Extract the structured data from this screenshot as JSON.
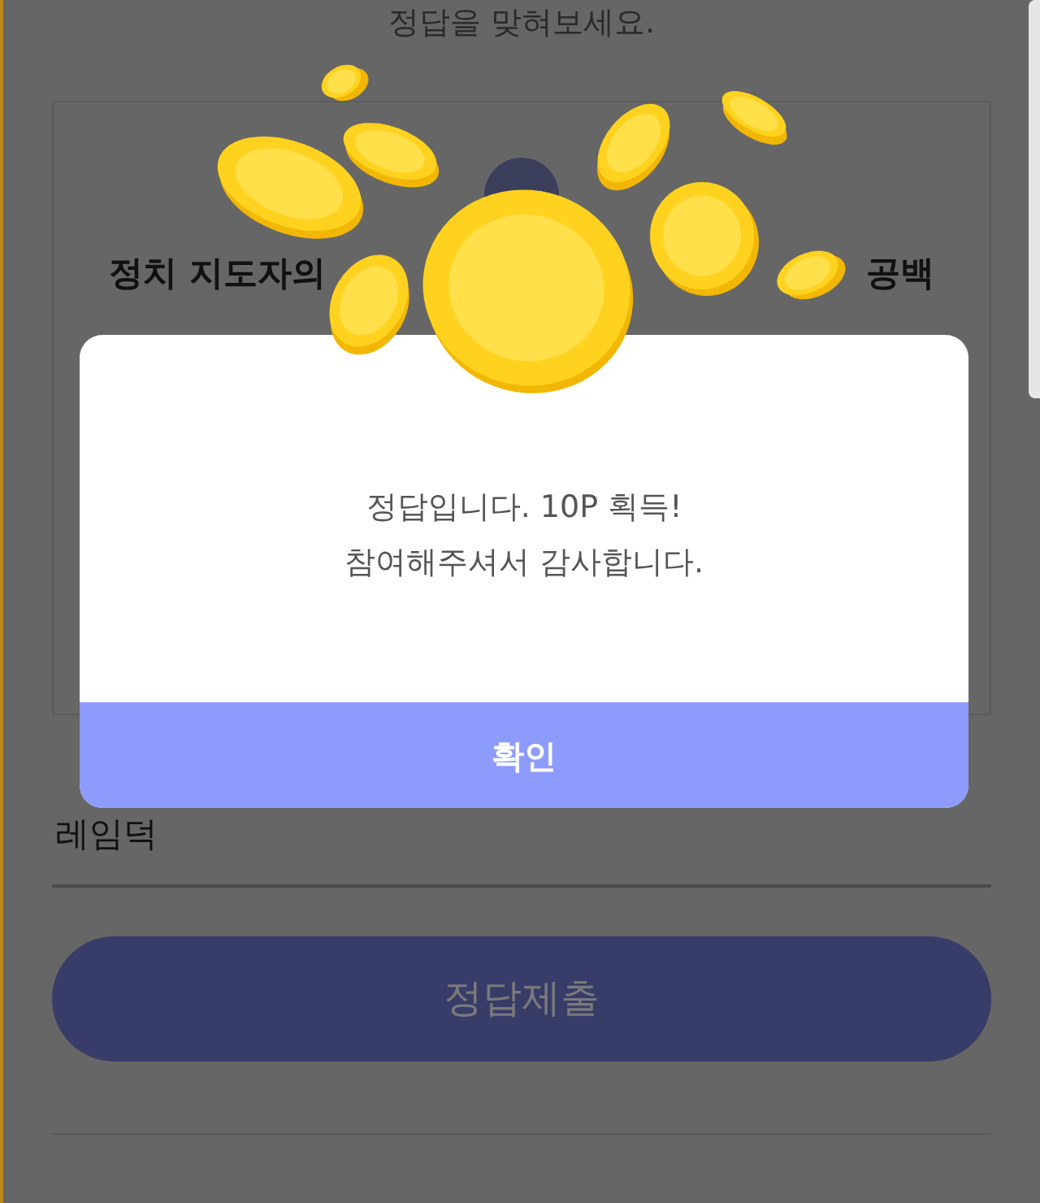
{
  "instruction": "정답을 맞혀보세요.",
  "question": {
    "title_parts": [
      "정치 지도자의",
      "공백"
    ]
  },
  "answer": {
    "value": "레임덕"
  },
  "submit_button": {
    "label": "정답제출",
    "disabled": true
  },
  "dialog": {
    "message_lines": [
      "정답입니다. 10P 획득!",
      "참여해주셔서 감사합니다."
    ],
    "confirm_button": "확인"
  }
}
